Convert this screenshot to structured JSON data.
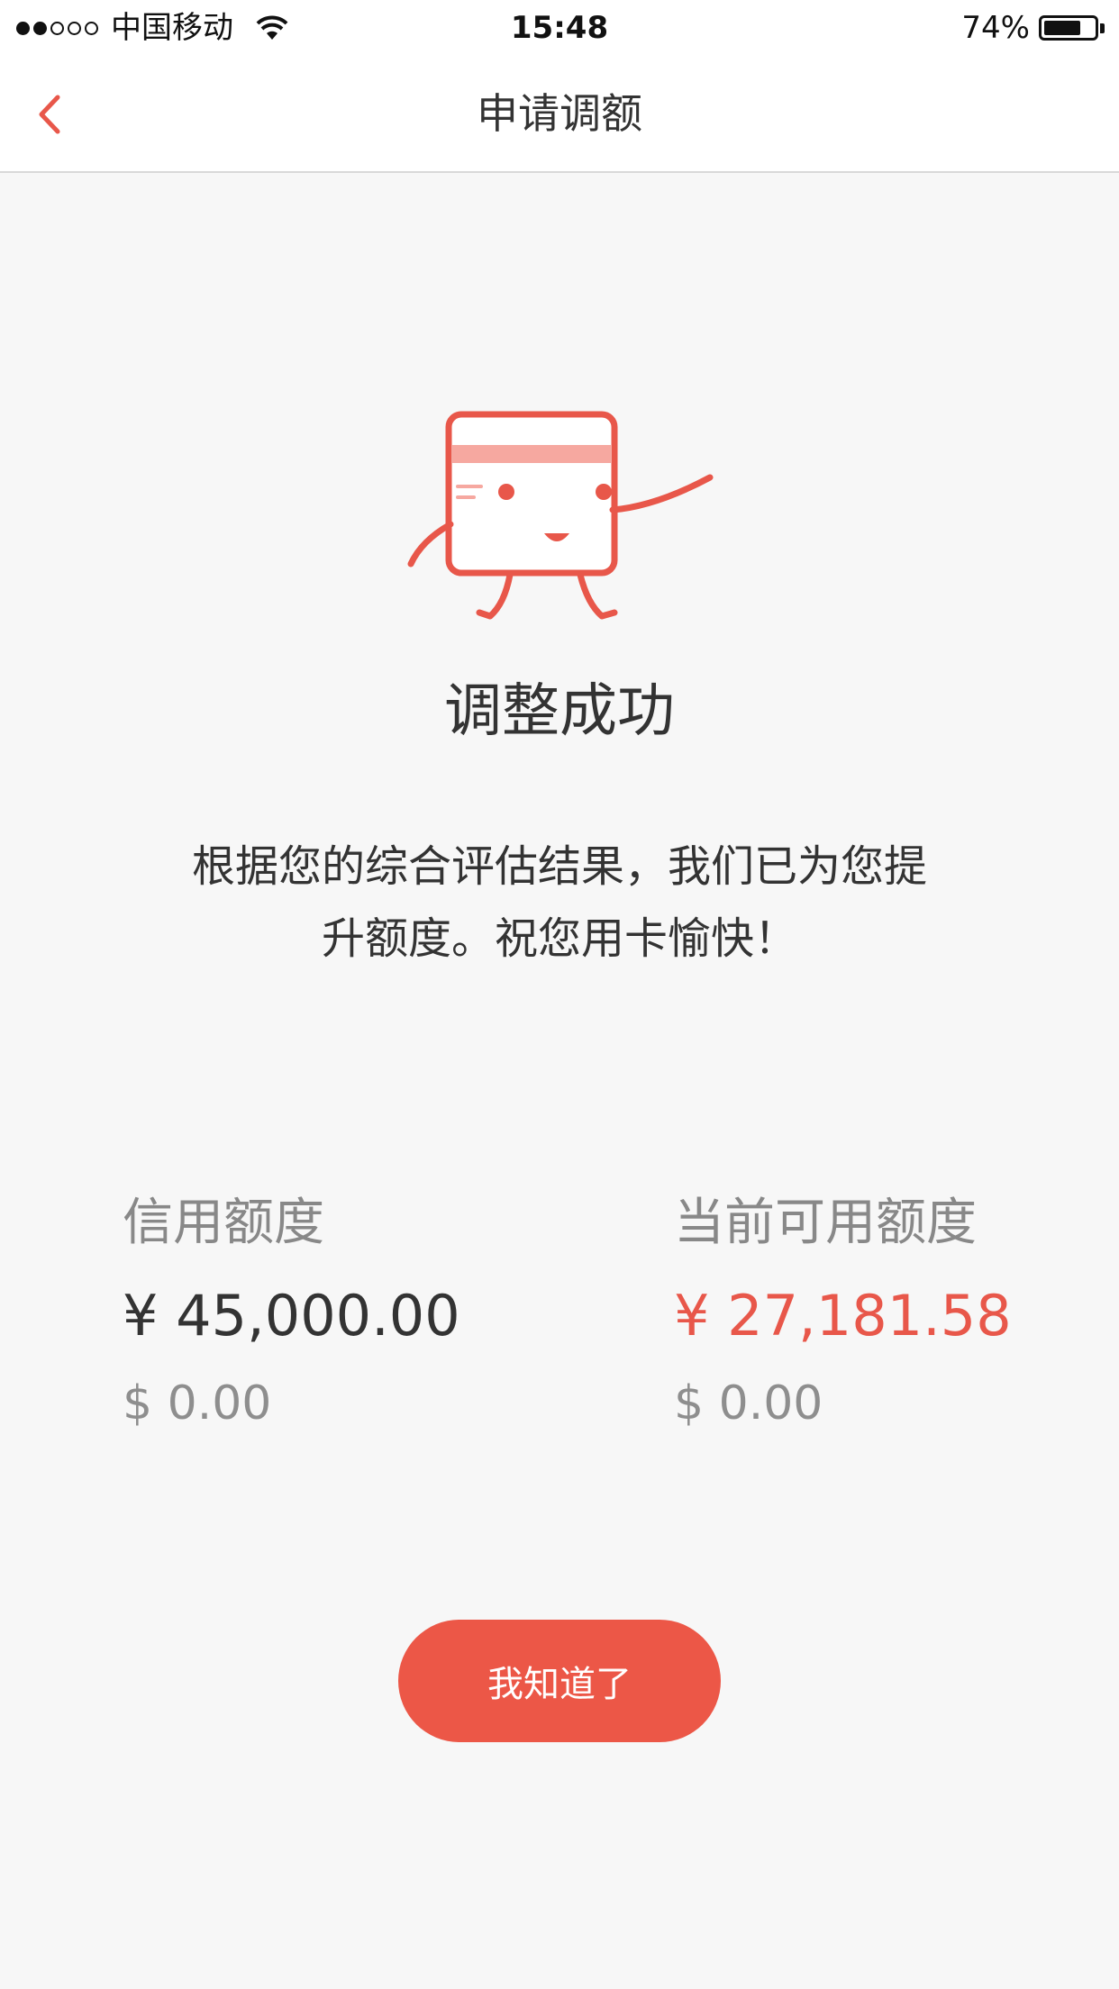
{
  "status_bar": {
    "carrier": "中国移动",
    "time": "15:48",
    "battery_percent_text": "74%",
    "battery_level": 0.74,
    "signal_bars_filled": 2,
    "signal_bars_total": 5
  },
  "nav": {
    "title": "申请调额",
    "back_icon": "chevron-left-icon"
  },
  "result": {
    "mascot_icon": "credit-card-mascot-icon",
    "title": "调整成功",
    "description_line1": "根据您的综合评估结果，我们已为您提",
    "description_line2": "升额度。祝您用卡愉快！"
  },
  "limits": {
    "credit": {
      "label": "信用额度",
      "cny": "¥ 45,000.00",
      "usd": "$ 0.00"
    },
    "available": {
      "label": "当前可用额度",
      "cny": "¥ 27,181.58",
      "usd": "$ 0.00"
    }
  },
  "actions": {
    "confirm_label": "我知道了"
  },
  "colors": {
    "accent": "#e8574a",
    "button": "#ec5747",
    "background": "#f7f7f7"
  }
}
